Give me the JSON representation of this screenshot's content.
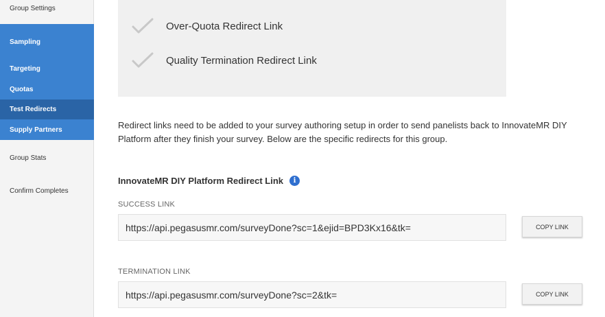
{
  "sidebar": {
    "items": [
      {
        "label": "Group Settings"
      },
      {
        "label": "Sampling"
      },
      {
        "label": "Targeting"
      },
      {
        "label": "Quotas"
      },
      {
        "label": "Test Redirects"
      },
      {
        "label": "Supply Partners"
      },
      {
        "label": "Group Stats"
      },
      {
        "label": "Confirm Completes"
      }
    ],
    "active_item": "Test Redirects",
    "accent_color": "#3b82d0",
    "active_color": "#2a64a6"
  },
  "checklist": {
    "items": [
      {
        "label": "Over-Quota Redirect Link",
        "icon": "checkmark-icon"
      },
      {
        "label": "Quality Termination Redirect Link",
        "icon": "checkmark-icon"
      }
    ]
  },
  "description": "Redirect links need to be added to your survey authoring setup in order to send panelists back to InnovateMR DIY Platform after they finish your survey. Below are the specific redirects for this group.",
  "redirect_section": {
    "title": "InnovateMR DIY Platform Redirect Link",
    "info_glyph": "i",
    "success": {
      "label": "SUCCESS LINK",
      "value": "https://api.pegasusmr.com/surveyDone?sc=1&ejid=BPD3Kx16&tk=",
      "button_label": "COPY LINK"
    },
    "termination": {
      "label": "TERMINATION LINK",
      "value": "https://api.pegasusmr.com/surveyDone?sc=2&tk=",
      "button_label": "COPY LINK"
    }
  }
}
